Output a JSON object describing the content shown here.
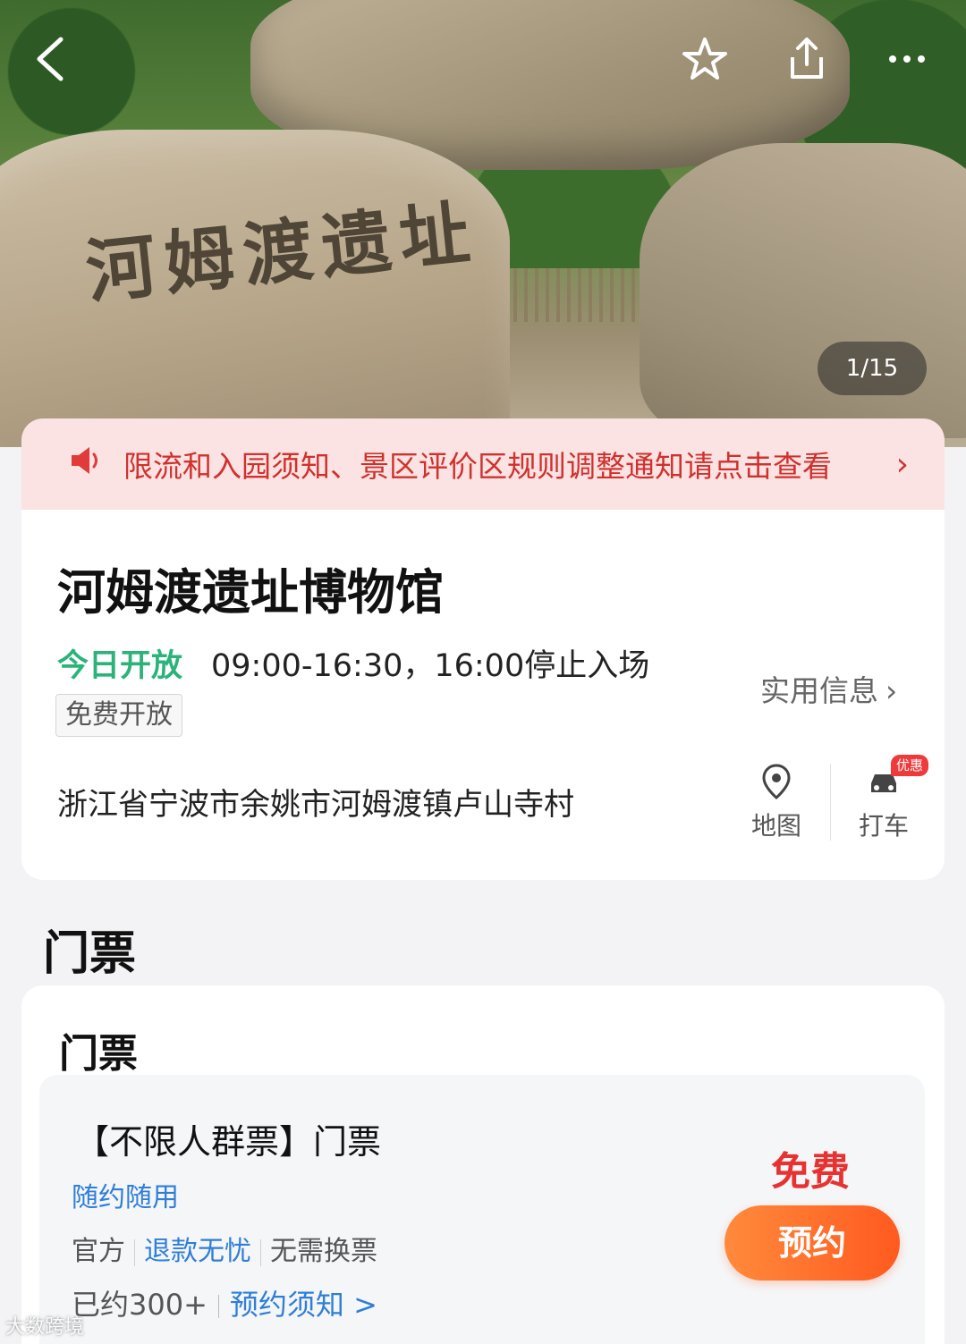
{
  "hero": {
    "inscription": "河姆渡遗址",
    "counter": "1/15",
    "icons": {
      "back": "chevron-left-icon",
      "favorite": "star-outline-icon",
      "share": "share-icon",
      "more": "more-dots-icon"
    }
  },
  "notice": {
    "icon": "speaker-icon",
    "text": "限流和入园须知、景区评价区规则调整通知请点击查看",
    "chevron": "›"
  },
  "info": {
    "title": "河姆渡遗址博物馆",
    "open_status": "今日开放",
    "hours": "09:00-16:30，16:00停止入场",
    "badge": "免费开放",
    "practical_info": "实用信息",
    "address": "浙江省宁波市余姚市河姆渡镇卢山寺村",
    "map_label": "地图",
    "taxi_label": "打车",
    "taxi_tag": "优惠"
  },
  "tickets": {
    "section_title": "门票",
    "card_title": "门票",
    "item": {
      "name": "【不限人群票】门票",
      "flex_use": "随约随用",
      "tag_official": "官方",
      "tag_refund": "退款无忧",
      "tag_no_exchange": "无需换票",
      "booked": "已约300+",
      "notice_link": "预约须知 >",
      "price": "免费",
      "book_button": "预约"
    }
  },
  "watermark": "大数跨境",
  "colors": {
    "accent_orange": "#ff5a1f",
    "price_red": "#e73232",
    "open_green": "#2bb37a",
    "link_blue": "#2f7ed8",
    "notice_bg": "#fbe3e3"
  }
}
